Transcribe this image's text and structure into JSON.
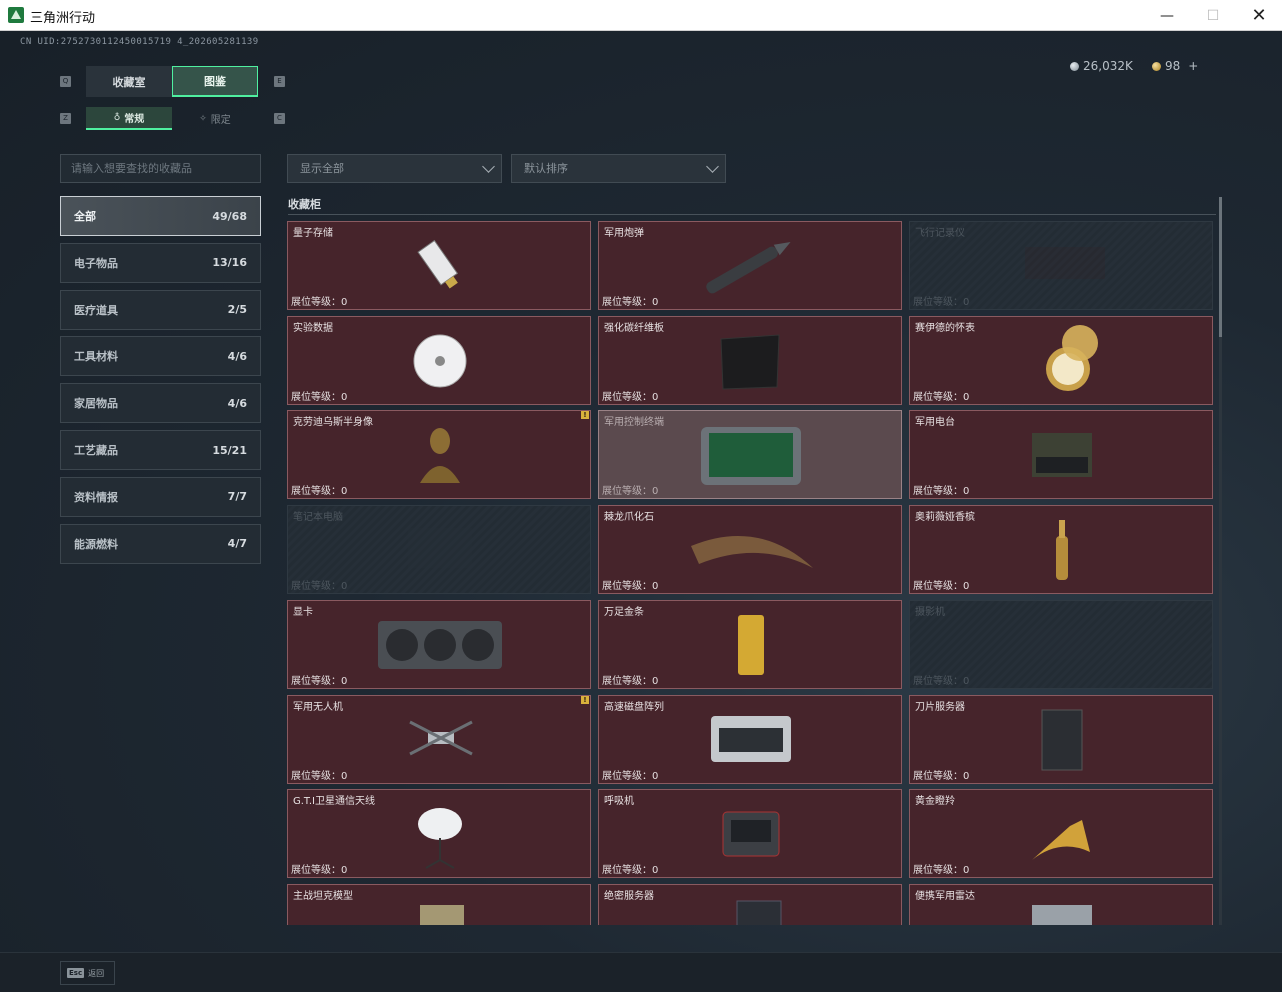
{
  "window": {
    "title": "三角洲行动",
    "minimize": "—",
    "maximize": "☐",
    "close": "✕"
  },
  "uid": "CN UID:2752730112450015719 4_202605281139",
  "currency": {
    "silver": "26,032K",
    "gold": "98",
    "add": "+"
  },
  "tabs": {
    "main": [
      "收藏室",
      "图鉴"
    ],
    "main_active": 1,
    "sub": [
      "常规",
      "限定"
    ],
    "sub_active": 0,
    "key_left": "Q",
    "key_right": "E",
    "key_sub_left": "Z",
    "key_sub_right": "C"
  },
  "search": {
    "placeholder": "请输入想要查找的收藏品"
  },
  "filters": {
    "show": "显示全部",
    "sort": "默认排序"
  },
  "categories": [
    {
      "label": "全部",
      "count": "49/68"
    },
    {
      "label": "电子物品",
      "count": "13/16"
    },
    {
      "label": "医疗道具",
      "count": "2/5"
    },
    {
      "label": "工具材料",
      "count": "4/6"
    },
    {
      "label": "家居物品",
      "count": "4/6"
    },
    {
      "label": "工艺藏品",
      "count": "15/21"
    },
    {
      "label": "资料情报",
      "count": "7/7"
    },
    {
      "label": "能源燃料",
      "count": "4/7"
    }
  ],
  "section": {
    "title": "收藏柜"
  },
  "level_label": "展位等级：0",
  "items": [
    {
      "name": "量子存储",
      "state": "owned",
      "icon": "usb-drive-icon"
    },
    {
      "name": "军用炮弹",
      "state": "owned",
      "icon": "artillery-shell-icon"
    },
    {
      "name": "飞行记录仪",
      "state": "locked",
      "icon": "flight-recorder-icon"
    },
    {
      "name": "实验数据",
      "state": "owned",
      "icon": "disc-icon"
    },
    {
      "name": "强化碳纤维板",
      "state": "owned",
      "icon": "carbon-plate-icon"
    },
    {
      "name": "赛伊德的怀表",
      "state": "owned",
      "icon": "pocket-watch-icon"
    },
    {
      "name": "克劳迪乌斯半身像",
      "state": "owned",
      "icon": "bust-icon",
      "flag": "!"
    },
    {
      "name": "军用控制终端",
      "state": "highlight",
      "icon": "control-terminal-icon"
    },
    {
      "name": "军用电台",
      "state": "owned",
      "icon": "radio-icon"
    },
    {
      "name": "笔记本电脑",
      "state": "locked",
      "icon": "laptop-icon"
    },
    {
      "name": "棘龙爪化石",
      "state": "owned",
      "icon": "claw-fossil-icon"
    },
    {
      "name": "奥莉薇娅香槟",
      "state": "owned",
      "icon": "champagne-icon"
    },
    {
      "name": "显卡",
      "state": "owned",
      "icon": "graphics-card-icon"
    },
    {
      "name": "万足金条",
      "state": "owned",
      "icon": "gold-bar-icon"
    },
    {
      "name": "摄影机",
      "state": "locked",
      "icon": "camera-icon"
    },
    {
      "name": "军用无人机",
      "state": "owned",
      "icon": "drone-icon",
      "flag": "!"
    },
    {
      "name": "高速磁盘阵列",
      "state": "owned",
      "icon": "disk-array-icon"
    },
    {
      "name": "刀片服务器",
      "state": "owned",
      "icon": "blade-server-icon"
    },
    {
      "name": "G.T.I卫星通信天线",
      "state": "owned",
      "icon": "satellite-dish-icon"
    },
    {
      "name": "呼吸机",
      "state": "owned",
      "icon": "ventilator-icon"
    },
    {
      "name": "黄金瞪羚",
      "state": "owned",
      "icon": "gold-gazelle-icon"
    },
    {
      "name": "主战坦克模型",
      "state": "owned",
      "icon": "tank-model-icon"
    },
    {
      "name": "绝密服务器",
      "state": "owned",
      "icon": "server-icon"
    },
    {
      "name": "便携军用雷达",
      "state": "owned",
      "icon": "radar-icon"
    }
  ],
  "bottom": {
    "key": "Esc",
    "label": "返回"
  },
  "colors": {
    "accent": "#4ff0a0",
    "owned_bg": "#46242b",
    "locked_bg": "#232c34"
  }
}
